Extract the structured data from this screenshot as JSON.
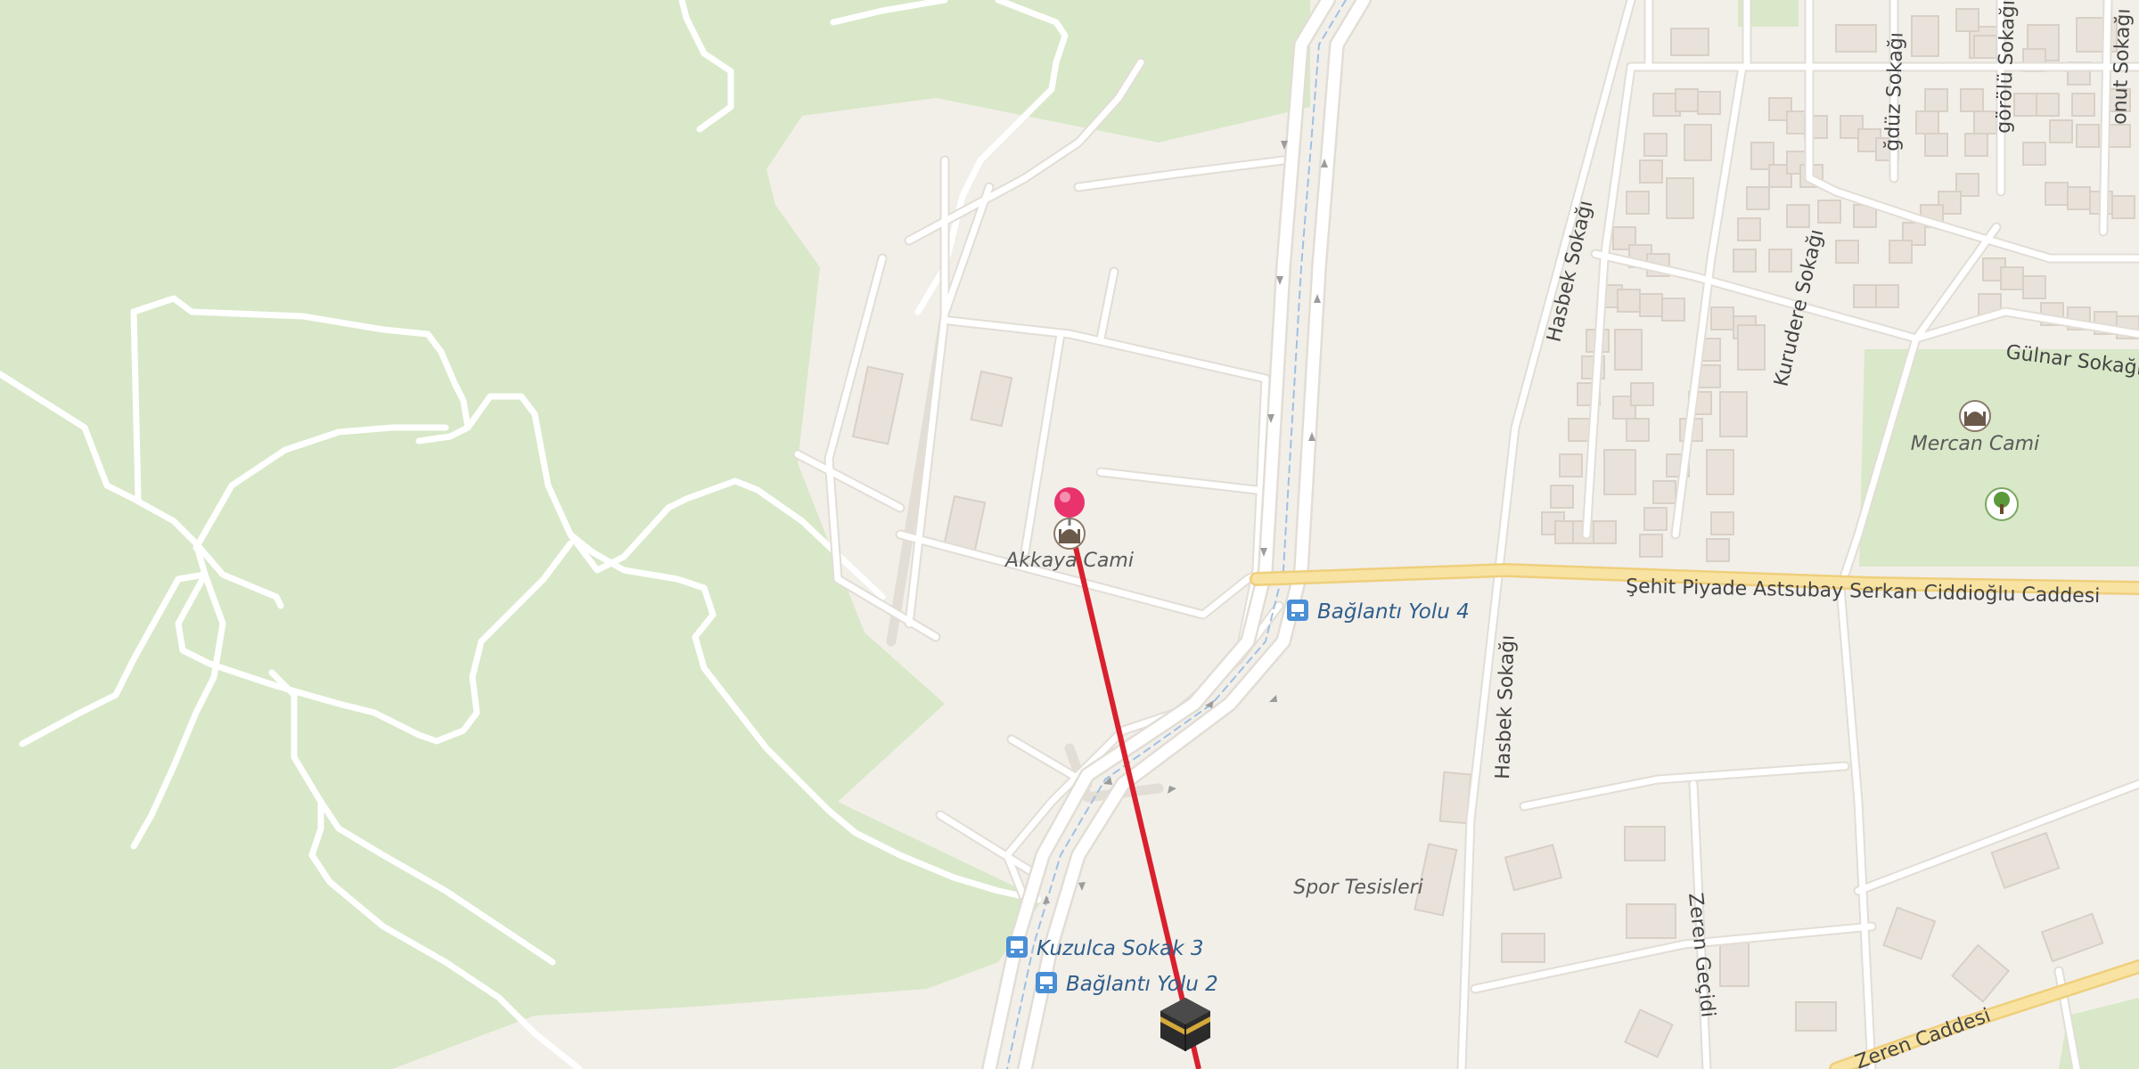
{
  "map": {
    "colors": {
      "land": "#f2efe9",
      "park": "#d9e8c8",
      "road": "#ffffff",
      "road_casing": "#e2ddd5",
      "main_road": "#f8e3a2",
      "main_road_casing": "#efcf7c",
      "building": "#e8e2da",
      "building_stroke": "#d8d0c6",
      "route_line": "#d9202e",
      "pin": "#e8336d",
      "bus_stop": "#4a8fd6"
    },
    "pois": [
      {
        "name": "Akkaya Cami",
        "icon": "mosque-icon"
      },
      {
        "name": "Mercan Cami",
        "icon": "mosque-icon"
      },
      {
        "name": "Spor Tesisleri",
        "icon": ""
      }
    ],
    "park_icon": "tree-icon",
    "bus_stops": [
      {
        "name": "Bağlantı Yolu 4"
      },
      {
        "name": "Kuzulca Sokak 3"
      },
      {
        "name": "Bağlantı Yolu 2"
      }
    ],
    "streets": [
      "Şehit Piyade Astsubay Serkan Ciddioğlu Caddesi",
      "Hasbek Sokağı",
      "Hasbek Sokağı",
      "Kurudere Sokağı",
      "Gülnar Sokağı",
      "Zeren Geçidi",
      "Zeren Caddesi",
      "ğdüz Sokağı",
      "görölü Sokağı",
      "onut Sokağı"
    ],
    "markers": {
      "location_pin": "location-pin-icon",
      "qibla": "kaaba-icon"
    }
  }
}
